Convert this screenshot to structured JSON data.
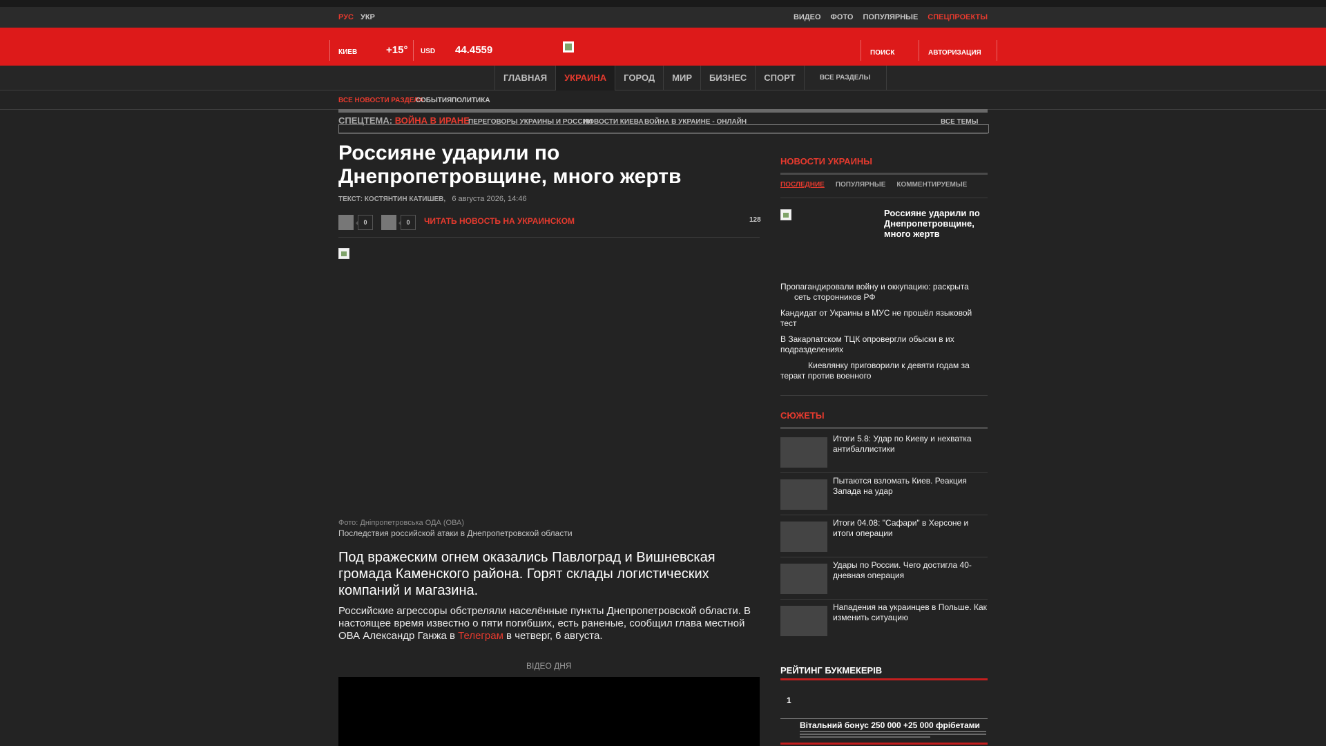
{
  "topbar": {
    "lang_ru": "РУС",
    "lang_ua": "УКР",
    "links": [
      "ВИДЕО",
      "ФОТО",
      "ПОПУЛЯРНЫЕ",
      "СПЕЦПРОЕКТЫ"
    ]
  },
  "header": {
    "city": "КИЕВ",
    "temperature": "+15°",
    "currency": "USD",
    "rate": "44.4559",
    "search": "ПОИСК",
    "login": "АВТОРИЗАЦИЯ",
    "brand_color": "#dd1a1a"
  },
  "nav": {
    "items": [
      "ГЛАВНАЯ",
      "УКРАИНА",
      "ГОРОД",
      "МИР",
      "БИЗНЕС",
      "СПОРТ"
    ],
    "active": "УКРАИНА",
    "all_sections": "ВСЕ РАЗДЕЛЫ"
  },
  "subnav": {
    "items": [
      "ВСЕ НОВОСТИ РАЗДЕЛА",
      "СОБЫТИЯ",
      "ПОЛИТИКА"
    ]
  },
  "spectopic": {
    "label": "СПЕЦТЕМА:",
    "value": "ВОЙНА В ИРАНЕ",
    "links": [
      "ПЕРЕГОВОРЫ УКРАИНЫ И РОССИИ",
      "НОВОСТИ КИЕВА",
      "ВОЙНА В УКРАИНЕ - ОНЛАЙН"
    ],
    "all": "ВСЕ ТЕМЫ"
  },
  "article": {
    "title": "Россияне ударили по Днепропетровщине, много жертв",
    "author_label": "ТЕКСТ: КОСТЯНТИН КАТИШЕВ,",
    "date": "6 августа 2026, 14:46",
    "share_count_1": "0",
    "share_count_2": "0",
    "read_ukr": "ЧИТАТЬ НОВОСТЬ НА УКРАИНСКОМ",
    "views": "128",
    "photo_credit": "Фото: Дніпропетровська ОДА (ОВА)",
    "photo_caption": "Последствия российской атаки в Днепропетровской области",
    "lead": "Под вражеским огнем оказались Павлоград и Вишневская громада Каменского района. Горят склады логистических компаний и магазина.",
    "body_before_link": "Российские агрессоры обстреляли населённые пункты Днепропетровской области. В настоящее время известно о пяти погибших, есть раненые, сообщил глава местной ОВА Александр Ганжа в ",
    "body_link": "Телеграм",
    "body_after_link": " в четверг, 6 августа.",
    "video_label": "ВІДЕО ДНЯ"
  },
  "sidebar": {
    "news_heading": "НОВОСТИ УКРАИНЫ",
    "tabs": [
      "ПОСЛЕДНИЕ",
      "ПОПУЛЯРНЫЕ",
      "КОММЕНТИРУЕМЫЕ"
    ],
    "featured": "Россияне ударили по Днепропетровщине, много жертв",
    "news": [
      "Пропагандировали войну и оккупацию: раскрыта сеть сторонников РФ",
      "Кандидат от Украины в МУС не прошёл языковой тест",
      "В Закарпатском ТЦК опровергли обыски в их подразделениях",
      "Киевлянку приговорили к девяти годам за теракт против военного"
    ],
    "stories_heading": "СЮЖЕТЫ",
    "stories": [
      "Итоги 5.8: Удар по Киеву и нехватка антибаллистики",
      "Пытаются взломать Киев. Реакция Запада на удар",
      "Итоги 04.08: \"Сафари\" в Херсоне и итоги операции",
      "Удары по России. Чего достигла 40-дневная операция",
      "Нападения на украинцев в Польше. Как изменить ситуацию"
    ],
    "rating_heading": "РЕЙТИНГ БУКМЕКЕРІВ",
    "rating_rank": "1",
    "bonus": "Вітальний бонус 250 000 +25 000 фрібетами"
  }
}
